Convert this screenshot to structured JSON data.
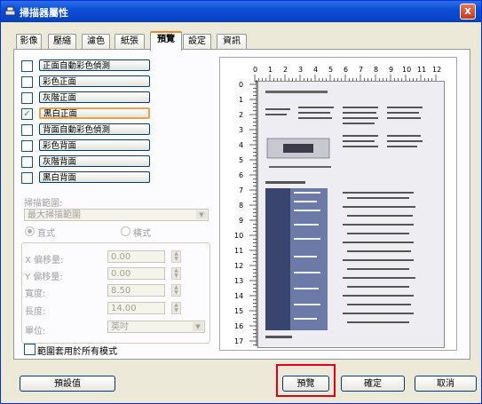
{
  "window": {
    "title": "掃描器屬性",
    "close_label": "x"
  },
  "tabs": [
    {
      "label": "影像"
    },
    {
      "label": "壓縮"
    },
    {
      "label": "濾色"
    },
    {
      "label": "紙張"
    },
    {
      "label": "預覽",
      "active": true
    },
    {
      "label": "設定"
    },
    {
      "label": "資訊"
    }
  ],
  "image_types": [
    {
      "label": "正面自動彩色偵測",
      "checked": false,
      "selected": false
    },
    {
      "label": "彩色正面",
      "checked": false,
      "selected": false
    },
    {
      "label": "灰階正面",
      "checked": false,
      "selected": false
    },
    {
      "label": "黑白正面",
      "checked": true,
      "selected": true
    },
    {
      "label": "背面自動彩色偵測",
      "checked": false,
      "selected": false
    },
    {
      "label": "彩色背面",
      "checked": false,
      "selected": false
    },
    {
      "label": "灰階背面",
      "checked": false,
      "selected": false
    },
    {
      "label": "黑白背面",
      "checked": false,
      "selected": false
    }
  ],
  "scan_area": {
    "label": "掃描範圍:",
    "value": "最大掃描範圍",
    "orientation_portrait": "直式",
    "orientation_landscape": "橫式"
  },
  "offsets": {
    "x_label": "X 偏移量:",
    "x_value": "0.00",
    "y_label": "Y 偏移量:",
    "y_value": "0.00",
    "width_label": "寬度:",
    "width_value": "8.50",
    "length_label": "長度:",
    "length_value": "14.00",
    "unit_label": "單位:",
    "unit_value": "英吋"
  },
  "apply_all_label": "範圍套用於所有模式",
  "ruler": {
    "h": [
      "0",
      "1",
      "2",
      "3",
      "4",
      "5",
      "6",
      "7",
      "8",
      "9",
      "10",
      "11",
      "12"
    ],
    "v": [
      "0",
      "1",
      "2",
      "3",
      "4",
      "5",
      "6",
      "7",
      "8",
      "9",
      "10",
      "11",
      "12",
      "13",
      "14",
      "15",
      "16",
      "17"
    ]
  },
  "buttons": {
    "defaults": "預設值",
    "preview": "預覽",
    "ok": "確定",
    "cancel": "取消"
  },
  "colors": {
    "title_bar": "#0a4fd6",
    "highlight": "#e0001a",
    "selected_border": "#f0a04a"
  }
}
